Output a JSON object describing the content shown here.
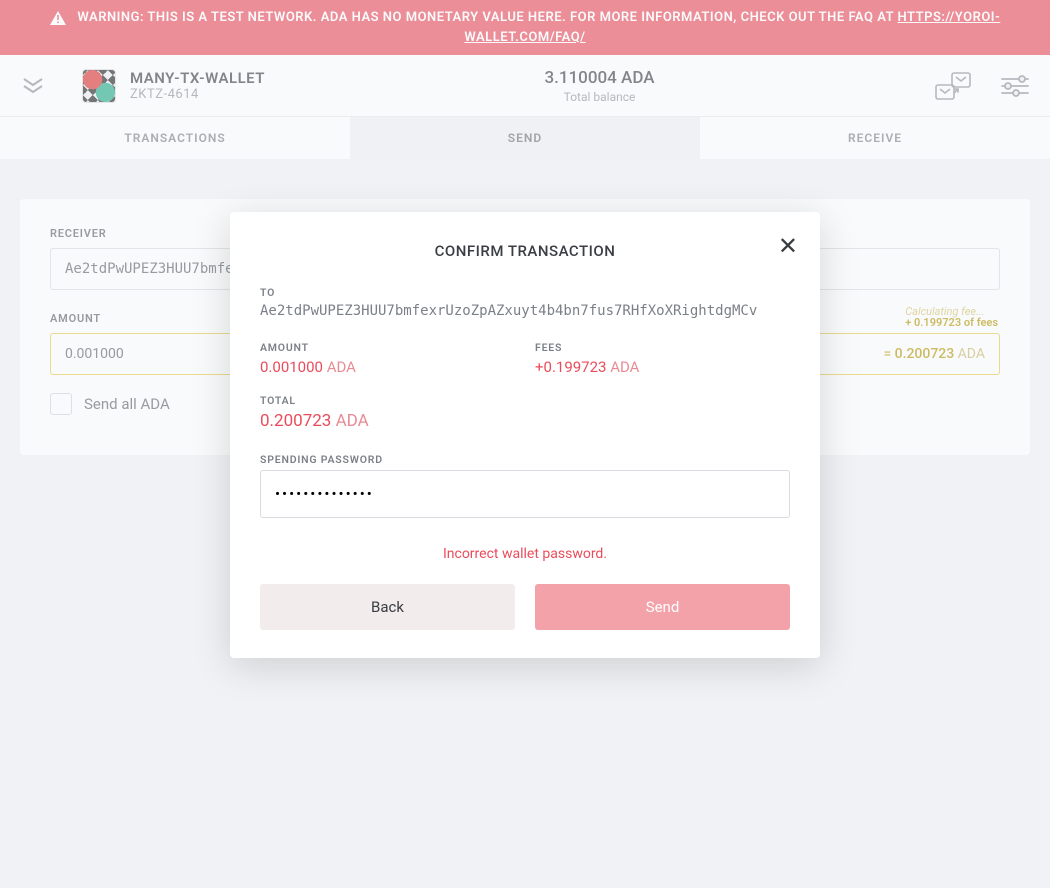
{
  "warning": {
    "text": "WARNING: THIS IS A TEST NETWORK. ADA HAS NO MONETARY VALUE HERE. FOR MORE INFORMATION, CHECK OUT THE FAQ AT ",
    "link_text": "HTTPS://YOROI-WALLET.COM/FAQ/"
  },
  "header": {
    "wallet_name": "MANY-TX-WALLET",
    "wallet_sub": "ZKTZ-4614",
    "balance_value": "3.110004 ADA",
    "balance_label": "Total balance"
  },
  "tabs": {
    "transactions": "TRANSACTIONS",
    "send": "SEND",
    "receive": "RECEIVE"
  },
  "send_form": {
    "receiver_label": "RECEIVER",
    "receiver_value": "Ae2tdPwUPEZ3HUU7bmfe",
    "amount_label": "AMOUNT",
    "amount_value": "0.001000",
    "fee_annot_calc": "Calculating fee...",
    "fee_annot_val": "+ 0.199723 of fees",
    "total_eq": "= ",
    "total_num": "0.200723",
    "total_cur": " ADA",
    "sendall_label": "Send all ADA"
  },
  "modal": {
    "title": "CONFIRM TRANSACTION",
    "to_label": "TO",
    "to_addr": "Ae2tdPwUPEZ3HUU7bmfexrUzoZpAZxuyt4b4bn7fus7RHfXoXRightdgMCv",
    "amount_label": "AMOUNT",
    "amount_num": "0.001000",
    "amount_cur": " ADA",
    "fees_label": "FEES",
    "fees_num": "+0.199723",
    "fees_cur": " ADA",
    "total_label": "TOTAL",
    "total_num": "0.200723",
    "total_cur": " ADA",
    "password_label": "SPENDING PASSWORD",
    "password_value": "••••••••••••••",
    "error": "Incorrect wallet password.",
    "back": "Back",
    "send": "Send"
  },
  "colors": {
    "danger": "#ea4c5b",
    "warn": "#b59700"
  }
}
